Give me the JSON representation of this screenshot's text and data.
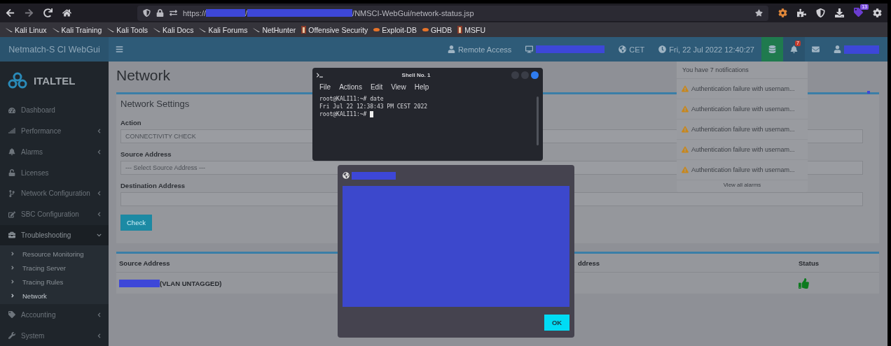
{
  "browser": {
    "url": {
      "scheme": "https://",
      "separator": "/",
      "path": "/NMSCI-WebGui/network-status.jsp"
    },
    "extension_badge": "13",
    "bookmarks": [
      {
        "label": "Kali Linux",
        "kind": "kali"
      },
      {
        "label": "Kali Training",
        "kind": "kali"
      },
      {
        "label": "Kali Tools",
        "kind": "kali"
      },
      {
        "label": "Kali Docs",
        "kind": "kali"
      },
      {
        "label": "Kali Forums",
        "kind": "kali"
      },
      {
        "label": "NetHunter",
        "kind": "kali"
      },
      {
        "label": "Offensive Security",
        "kind": "offsec"
      },
      {
        "label": "Exploit-DB",
        "kind": "exploit"
      },
      {
        "label": "GHDB",
        "kind": "exploit"
      },
      {
        "label": "MSFU",
        "kind": "offsec"
      }
    ]
  },
  "header": {
    "brand": "Netmatch-S CI WebGui",
    "remote_access": "Remote Access",
    "timezone": "CET",
    "datetime": "Fri, 22 Jul 2022 12:40:27",
    "bell_badge": "7"
  },
  "sidebar": {
    "logo": "ITALTEL",
    "items": [
      {
        "label": "Dashboard",
        "has_submenu": false,
        "expanded": false
      },
      {
        "label": "Performance",
        "has_submenu": true,
        "expanded": false
      },
      {
        "label": "Alarms",
        "has_submenu": true,
        "expanded": false
      },
      {
        "label": "Licenses",
        "has_submenu": false,
        "expanded": false
      },
      {
        "label": "Network Configuration",
        "has_submenu": true,
        "expanded": false
      },
      {
        "label": "SBC Configuration",
        "has_submenu": true,
        "expanded": false
      },
      {
        "label": "Troubleshooting",
        "has_submenu": true,
        "expanded": true,
        "children": [
          {
            "label": "Resource Monitoring",
            "selected": false
          },
          {
            "label": "Tracing Server",
            "selected": false
          },
          {
            "label": "Tracing Rules",
            "selected": false
          },
          {
            "label": "Network",
            "selected": true
          }
        ]
      },
      {
        "label": "Accounting",
        "has_submenu": true,
        "expanded": false
      },
      {
        "label": "System",
        "has_submenu": true,
        "expanded": false
      }
    ]
  },
  "page": {
    "title": "Network",
    "settings": {
      "title": "Network Settings",
      "fields": [
        {
          "label": "Action",
          "value": "CONNECTIVITY CHECK"
        },
        {
          "label": "Source Address",
          "value": "--- Select Source Address ---"
        },
        {
          "label": "Destination Address"
        }
      ],
      "button": "Check"
    },
    "table": {
      "columns": [
        "Source Address",
        "ddress",
        "Status"
      ],
      "rows": [
        {
          "source": "(VLAN UNTAGGED)",
          "ok": true
        }
      ]
    }
  },
  "shell": {
    "title": "Shell No. 1",
    "menu": [
      "File",
      "Actions",
      "Edit",
      "View",
      "Help"
    ],
    "lines": [
      "root@KALI11:~# date",
      "Fri Jul 22 12:38:43 PM CEST 2022",
      "root@KALI11:~# "
    ]
  },
  "dialog": {
    "button": "OK"
  },
  "notifications": {
    "header": "You have 7 notifications",
    "items": [
      "Authentication failure with usernam...",
      "Authentication failure with usernam...",
      "Authentication failure with usernam...",
      "Authentication failure with usernam...",
      "Authentication failure with usernam..."
    ],
    "footer": "View all alarms"
  }
}
